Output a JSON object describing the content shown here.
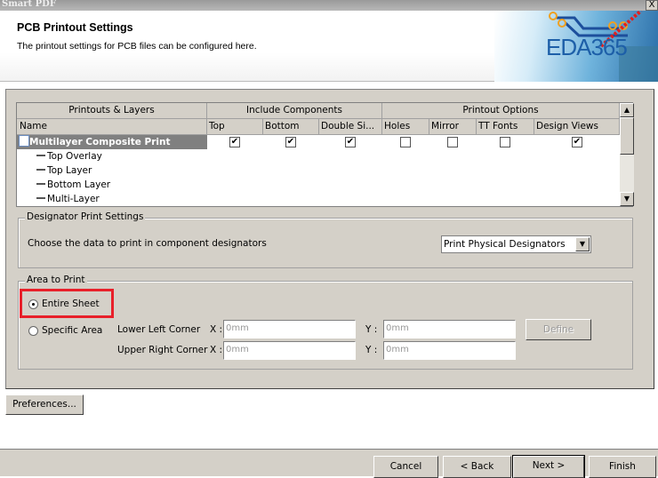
{
  "window": {
    "title": "Smart PDF",
    "close": "X"
  },
  "header": {
    "title": "PCB Printout Settings",
    "subtitle": "The printout settings for PCB files can be configured here.",
    "logo_text": "EDA365"
  },
  "table": {
    "group_headers": [
      "Printouts & Layers",
      "Include Components",
      "Printout Options"
    ],
    "columns": [
      "Name",
      "Top",
      "Bottom",
      "Double Si...",
      "Holes",
      "Mirror",
      "TT Fonts",
      "Design Views"
    ],
    "rows": [
      {
        "name": "Multilayer Composite Print",
        "selected": true,
        "checks": [
          true,
          true,
          true,
          false,
          false,
          false,
          true
        ]
      },
      {
        "name": "Top Overlay"
      },
      {
        "name": "Top Layer"
      },
      {
        "name": "Bottom Layer"
      },
      {
        "name": "Multi-Layer"
      }
    ],
    "check_mark": "✔"
  },
  "designator": {
    "group_label": "Designator Print Settings",
    "prompt": "Choose the data to print in component designators",
    "selected": "Print Physical Designators"
  },
  "area": {
    "group_label": "Area to Print",
    "entire_sheet": "Entire Sheet",
    "specific_area": "Specific Area",
    "selected": "Entire Sheet",
    "lower_left_label": "Lower Left Corner",
    "upper_right_label": "Upper Right Corner",
    "x_label": "X :",
    "y_label": "Y :",
    "ll_x": "0mm",
    "ll_y": "0mm",
    "ur_x": "0mm",
    "ur_y": "0mm",
    "define": "Define"
  },
  "preferences": "Preferences...",
  "footer": {
    "cancel": "Cancel",
    "back": "< Back",
    "next": "Next >",
    "finish": "Finish"
  },
  "colors": {
    "highlight_box": "#e8202a",
    "panel": "#d4d0c8",
    "selected_row": "#808080"
  }
}
